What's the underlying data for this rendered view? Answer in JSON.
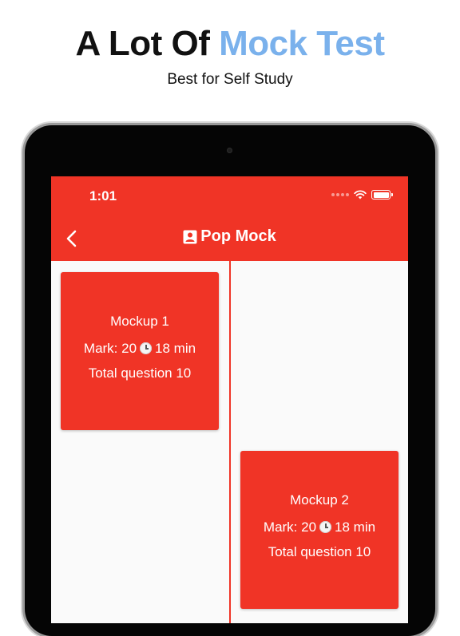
{
  "promo": {
    "headline_start": "A Lot Of ",
    "headline_accent": "Mock Test",
    "subheadline": "Best for Self Study",
    "accent_color": "#7ab1ec"
  },
  "status_bar": {
    "time": "1:01",
    "icons": [
      "signal-dots-icon",
      "wifi-icon",
      "battery-icon"
    ]
  },
  "app_bar": {
    "title": "Pop Mock",
    "back_icon": "chevron-left-icon",
    "title_icon": "account-box-icon",
    "color": "#f03426"
  },
  "mockups": [
    {
      "name": "Mockup 1",
      "mark_prefix": "Mark: 20",
      "duration": "18 min",
      "total": "Total question 10"
    },
    {
      "name": "Mockup 2",
      "mark_prefix": "Mark: 20",
      "duration": "18 min",
      "total": "Total question 10"
    }
  ]
}
